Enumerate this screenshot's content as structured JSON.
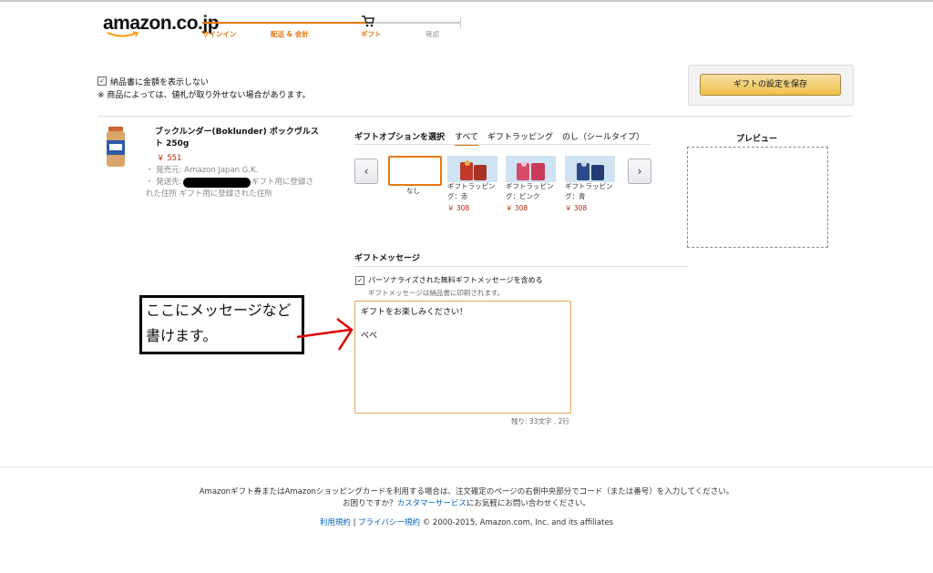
{
  "header": {
    "logo": "amazon.co.jp",
    "steps": [
      {
        "label": "サインイン",
        "active": true
      },
      {
        "label": "配送 & 会計",
        "active": true
      },
      {
        "label": "ギフト",
        "active": true
      },
      {
        "label": "確認",
        "active": false
      }
    ]
  },
  "options": {
    "hide_price_label": "納品書に金額を表示しない",
    "note": "※ 商品によっては、値札が取り外せない場合があります。"
  },
  "save_button": "ギフトの設定を保存",
  "product": {
    "title": "ブックルンダー(Boklunder) ボックヴルスト 250g",
    "price": "￥ 551",
    "seller": "・ 発売元: Amazon Japan G.K.",
    "ship_prefix": "・ 発送先:",
    "ship_rest": "ギフト用に登録された住所 ギフト用に登録された住所"
  },
  "gift_options": {
    "section_label": "ギフトオプションを選択",
    "tabs": [
      "すべて",
      "ギフトラッピング",
      "のし（シールタイプ）"
    ],
    "prev": "‹",
    "next": "›",
    "none_label": "なし",
    "items": [
      {
        "label": "ギフトラッピング：赤",
        "price": "￥ 308",
        "color": "#c0392b"
      },
      {
        "label": "ギフトラッピング：ピンク",
        "price": "￥ 308",
        "color": "#d64b6b"
      },
      {
        "label": "ギフトラッピング：青",
        "price": "￥ 308",
        "color": "#2c4a8a"
      }
    ]
  },
  "preview": {
    "label": "プレビュー"
  },
  "gift_message": {
    "section_label": "ギフトメッセージ",
    "include_label": "パーソナライズされた無料ギフトメッセージを含める",
    "print_note": "ギフトメッセージは納品書に印刷されます。",
    "line1": "ギフトをお楽しみください！",
    "line2": "べべ",
    "counter": "残り: 33文字 , 2行"
  },
  "annotation": {
    "line1": "ここにメッセージなど",
    "line2": "書けます。"
  },
  "footer": {
    "line1": "Amazonギフト券またはAmazonショッピングカードを利用する場合は、注文確定のページの右側中央部分でコード（または番号）を入力してください。",
    "help_prefix": "お困りですか？",
    "help_link": "カスタマーサービス",
    "help_suffix": "にお気軽にお問い合わせください。",
    "terms_link": "利用規約",
    "sep": " | ",
    "privacy_link": "プライバシー規約",
    "copyright": " © 2000-2015, Amazon.com, Inc. and its affiliates"
  },
  "colors": {
    "accent": "#e47911",
    "price": "#b12704",
    "link": "#0066c0",
    "button": "#f0c14b"
  }
}
